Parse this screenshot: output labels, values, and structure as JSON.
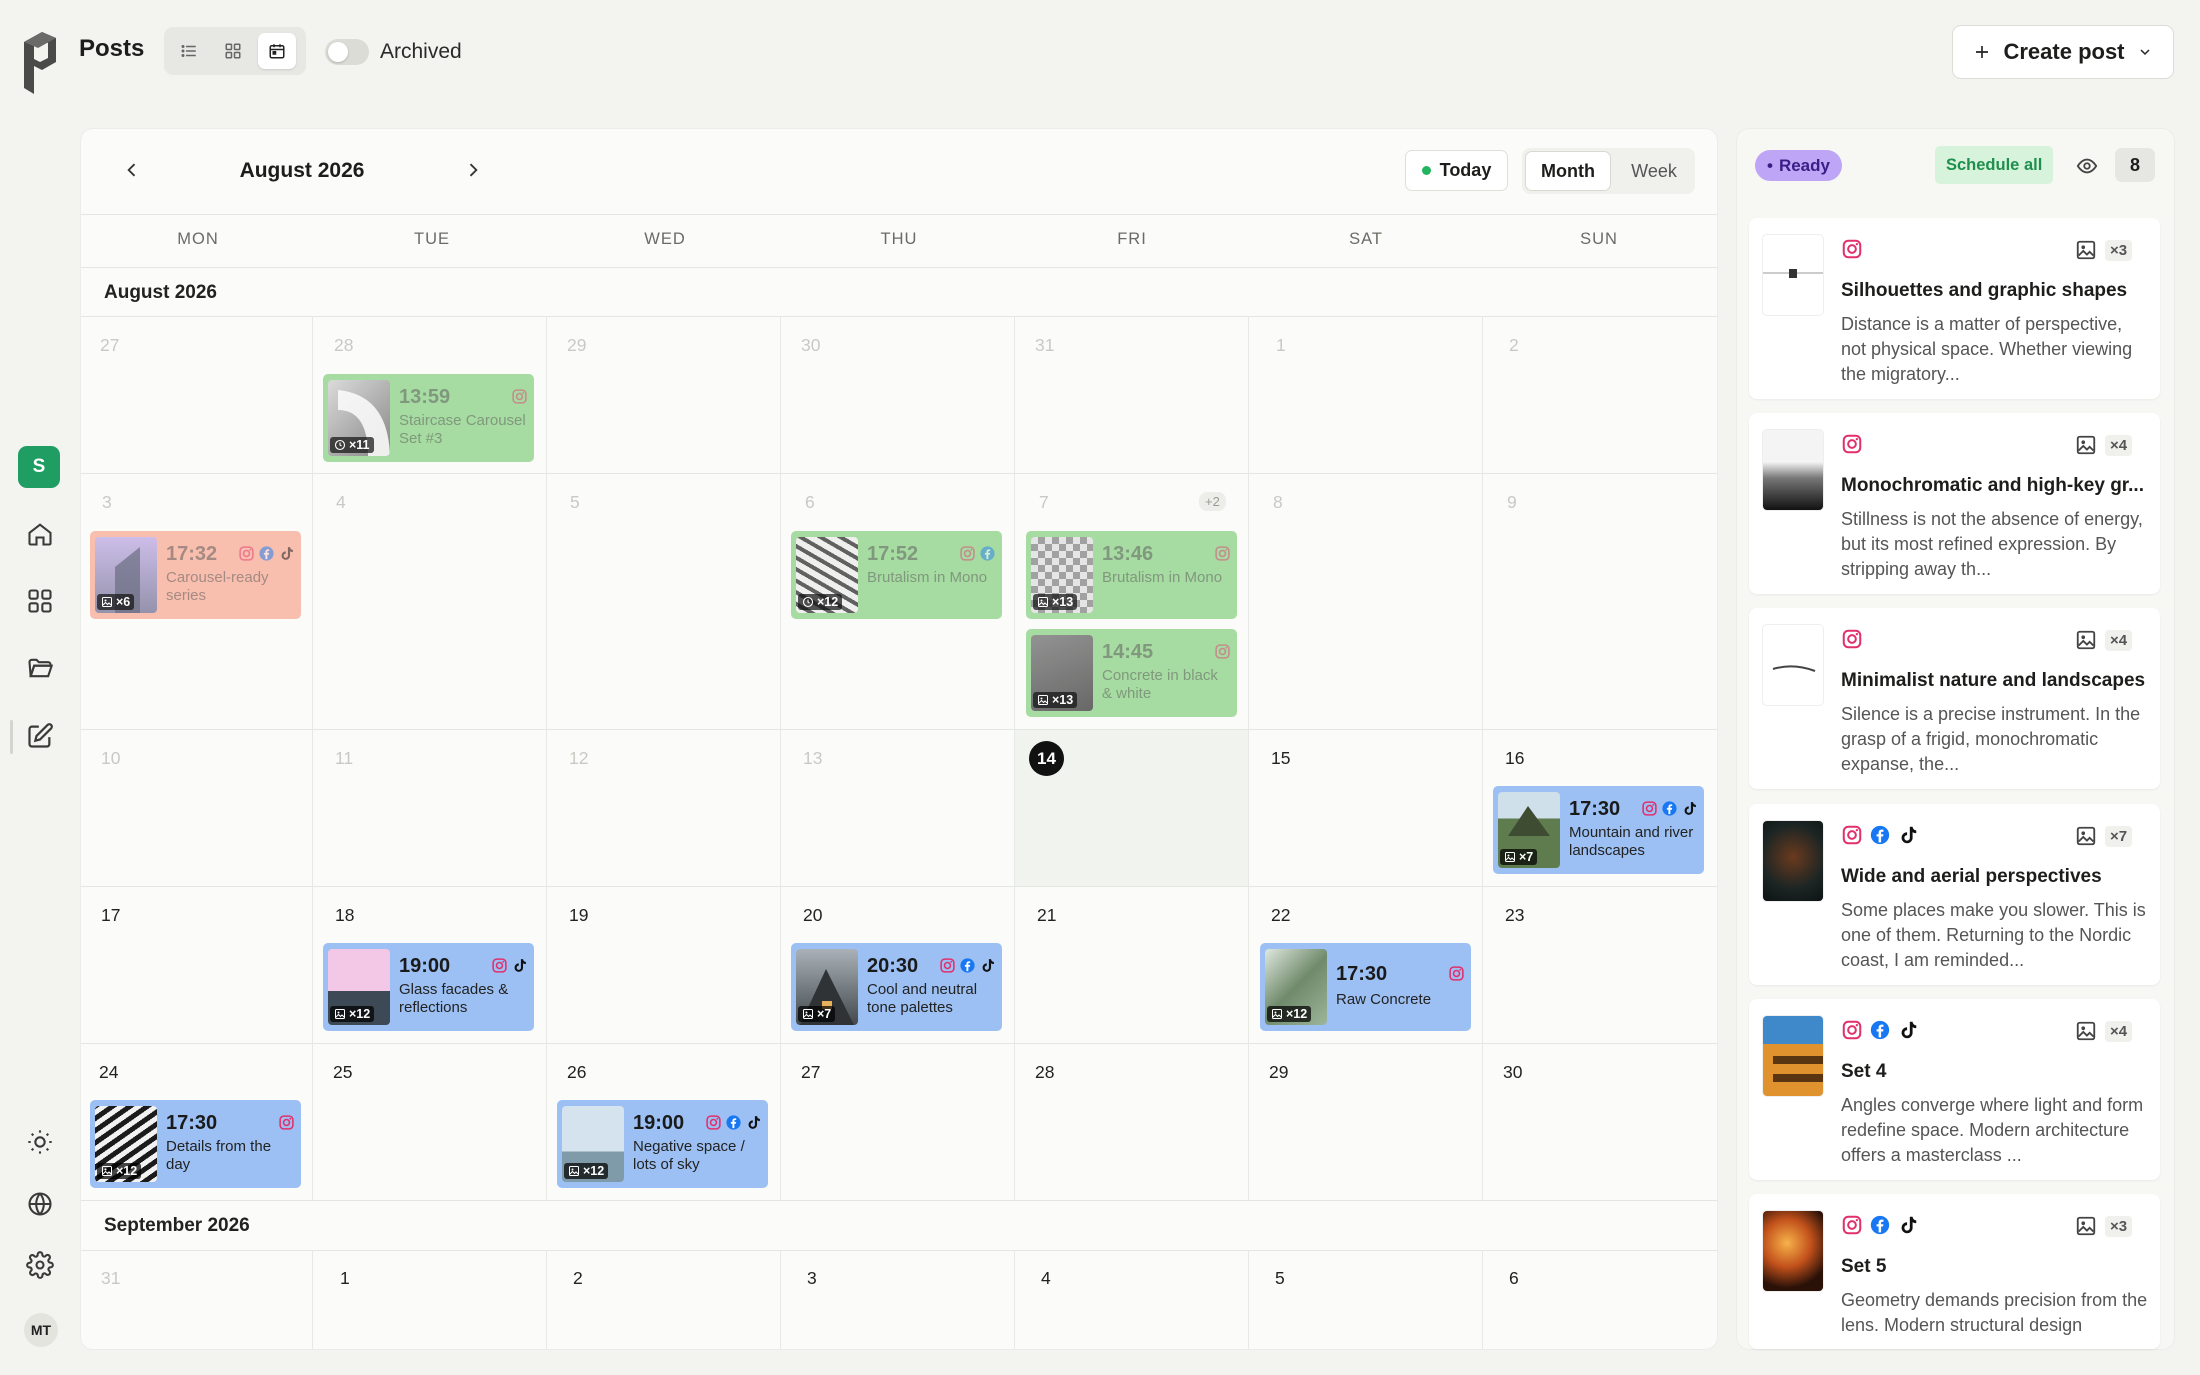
{
  "header": {
    "title": "Posts",
    "archived_label": "Archived",
    "create_label": "Create post"
  },
  "calendar": {
    "title": "August 2026",
    "today_label": "Today",
    "month_label": "Month",
    "week_label": "Week",
    "weekdays": [
      "MON",
      "TUE",
      "WED",
      "THU",
      "FRI",
      "SAT",
      "SUN"
    ],
    "section_aug": "August 2026",
    "section_sep": "September 2026",
    "more_badge": "+2",
    "days": {
      "w1": [
        "27",
        "28",
        "29",
        "30",
        "31",
        "1",
        "2"
      ],
      "w2": [
        "3",
        "4",
        "5",
        "6",
        "7",
        "8",
        "9"
      ],
      "w3": [
        "10",
        "11",
        "12",
        "13",
        "14",
        "15",
        "16"
      ],
      "w4": [
        "17",
        "18",
        "19",
        "20",
        "21",
        "22",
        "23"
      ],
      "w5": [
        "24",
        "25",
        "26",
        "27",
        "28",
        "29",
        "30"
      ],
      "w6": [
        "31",
        "1",
        "2",
        "3",
        "4",
        "5",
        "6"
      ]
    },
    "events": [
      {
        "time": "13:59",
        "title": "Staircase Carousel Set #3",
        "count": "×11"
      },
      {
        "time": "17:32",
        "title": "Carousel-ready series",
        "count": "×6"
      },
      {
        "time": "17:52",
        "title": "Brutalism in Mono",
        "count": "×12"
      },
      {
        "time": "13:46",
        "title": "Brutalism in Mono",
        "count": "×13"
      },
      {
        "time": "14:45",
        "title": "Concrete in black & white",
        "count": "×13"
      },
      {
        "time": "17:30",
        "title": "Mountain and river landscapes",
        "count": "×7"
      },
      {
        "time": "19:00",
        "title": "Glass facades & reflections",
        "count": "×12"
      },
      {
        "time": "20:30",
        "title": "Cool and neutral tone palettes",
        "count": "×7"
      },
      {
        "time": "17:30",
        "title": "Raw Concrete",
        "count": "×12"
      },
      {
        "time": "17:30",
        "title": "Details from the day",
        "count": "×12"
      },
      {
        "time": "19:00",
        "title": "Negative space / lots of sky",
        "count": "×12"
      }
    ]
  },
  "queue": {
    "status": "Ready",
    "schedule_all": "Schedule all",
    "count": "8",
    "items": [
      {
        "title": "Silhouettes and graphic shapes",
        "body": "Distance is a matter of perspective, not physical space. Whether viewing the migratory...",
        "count": "×3"
      },
      {
        "title": "Monochromatic and high-key gr...",
        "body": "Stillness is not the absence of energy, but its most refined expression. By stripping away th...",
        "count": "×4"
      },
      {
        "title": "Minimalist nature and landscapes",
        "body": "Silence is a precise instrument. In the grasp of a frigid, monochromatic expanse, the...",
        "count": "×4"
      },
      {
        "title": "Wide and aerial perspectives",
        "body": "Some places make you slower. This is one of them. Returning to the Nordic coast, I am reminded...",
        "count": "×7"
      },
      {
        "title": "Set 4",
        "body": "Angles converge where light and form redefine space. Modern architecture offers a masterclass ...",
        "count": "×4"
      },
      {
        "title": "Set 5",
        "body": "Geometry demands precision from the lens. Modern structural design",
        "count": "×3"
      }
    ]
  },
  "rail": {
    "workspace": "S",
    "avatar": "MT"
  },
  "colors": {
    "scheduled": "#9cc0f4",
    "published": "#9fd99a",
    "failed": "#f8b9a8",
    "ready": "#bfa5f5",
    "accent": "#1f9d63"
  }
}
